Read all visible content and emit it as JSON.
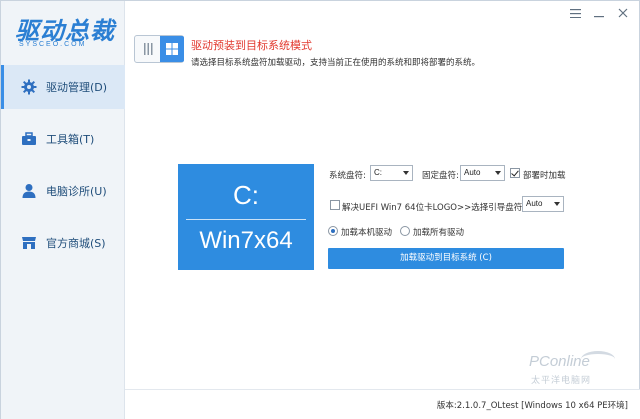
{
  "app": {
    "logo_text": "驱动总裁",
    "logo_sub": "SYSCEO.COM"
  },
  "window_controls": {
    "menu_icon": "menu-icon",
    "minimize_icon": "minimize-icon",
    "close_icon": "close-icon"
  },
  "sidebar": {
    "items": [
      {
        "label": "驱动管理(D)",
        "icon": "gear-icon",
        "active": true
      },
      {
        "label": "工具箱(T)",
        "icon": "toolbox-icon",
        "active": false
      },
      {
        "label": "电脑诊所(U)",
        "icon": "user-icon",
        "active": false
      },
      {
        "label": "官方商城(S)",
        "icon": "store-icon",
        "active": false
      }
    ]
  },
  "header": {
    "title": "驱动预装到目标系统模式",
    "description": "请选择目标系统盘符加载驱动，支持当前正在使用的系统和即将部署的系统。"
  },
  "drive_tile": {
    "letter": "C:",
    "os": "Win7x64"
  },
  "options": {
    "system_drive_label": "系统盘符:",
    "system_drive_value": "C:",
    "fixed_drive_label": "固定盘符:",
    "fixed_drive_value": "Auto",
    "deploy_load_label": "部署时加载",
    "deploy_load_checked": true,
    "uefi_label": "解决UEFI Win7 64位卡LOGO>>选择引导盘符:",
    "uefi_checked": false,
    "boot_drive_value": "Auto",
    "radio_local_label": "加载本机驱动",
    "radio_local_checked": true,
    "radio_all_label": "加载所有驱动",
    "radio_all_checked": false,
    "load_button_label": "加载驱动到目标系统 (C)"
  },
  "watermark": {
    "main": "PConline",
    "sub": "太平洋电脑网"
  },
  "status": {
    "version": "版本:2.1.0.7_OLtest [Windows 10 x64 PE环境]"
  },
  "colors": {
    "accent": "#2e8ce0",
    "title_red": "#e23a2f",
    "sidebar_bg": "#f0f4f8",
    "nav_text": "#1f4d7a"
  }
}
